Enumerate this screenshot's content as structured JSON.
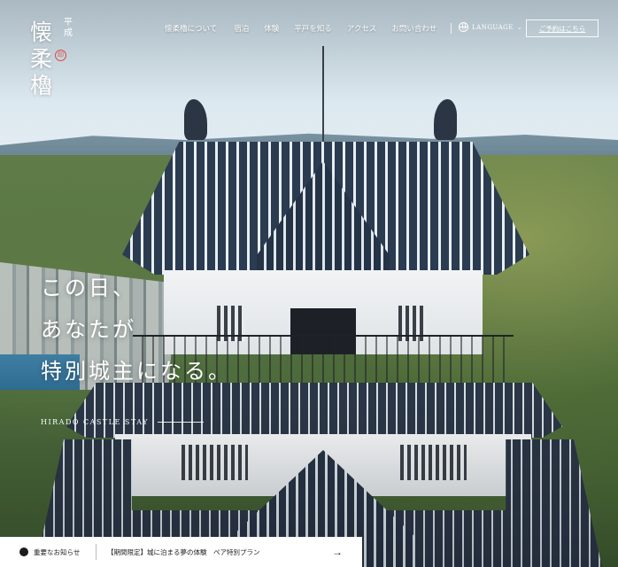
{
  "logo": {
    "main": "懐柔櫓",
    "era": "平成",
    "seal": "印"
  },
  "nav": {
    "items": [
      {
        "label": "懐柔櫓について"
      },
      {
        "label": "宿泊"
      },
      {
        "label": "体験"
      },
      {
        "label": "平戸を知る"
      },
      {
        "label": "アクセス"
      },
      {
        "label": "お問い合わせ"
      }
    ],
    "language": "LANGUAGE",
    "reserve": "ご予約はこちら"
  },
  "hero": {
    "lines": [
      "この日、",
      "あなたが",
      "特別城主になる。"
    ],
    "caption": "HIRADO CASTLE STAY"
  },
  "news": {
    "tag": "重要なお知らせ",
    "text": "【期間限定】城に泊まる夢の体験　ペア特別プラン",
    "arrow": "→"
  },
  "icons": {
    "language": "globe-icon",
    "alert": "exclamation-icon",
    "next": "arrow-right-icon"
  }
}
